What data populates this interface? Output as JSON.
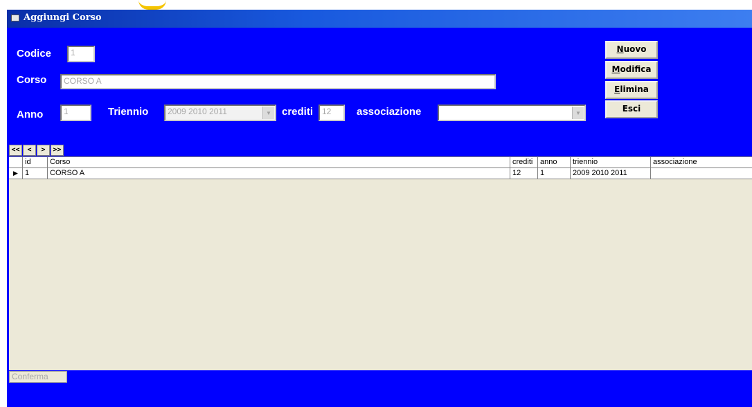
{
  "window": {
    "title": "Aggiungi Corso"
  },
  "form": {
    "codice_label": "Codice",
    "codice_value": "1",
    "corso_label": "Corso",
    "corso_value": "CORSO A",
    "anno_label": "Anno",
    "anno_value": "1",
    "triennio_label": "Triennio",
    "triennio_value": "2009 2010 2011",
    "crediti_label": "crediti",
    "crediti_value": "12",
    "associazione_label": "associazione",
    "associazione_value": ""
  },
  "buttons": {
    "nuovo_first": "N",
    "nuovo_rest": "uovo",
    "modifica_first": "M",
    "modifica_rest": "odifica",
    "elimina_first": "E",
    "elimina_rest": "limina",
    "esci": "Esci",
    "conferma": "Conferma"
  },
  "navigator": {
    "first": "<<",
    "prev": "<",
    "next": ">",
    "last": ">>"
  },
  "grid": {
    "headers": {
      "id": "id",
      "corso": "Corso",
      "crediti": "crediti",
      "anno": "anno",
      "triennio": "triennio",
      "associazione": "associazione"
    },
    "rows": [
      {
        "id": "1",
        "corso": "CORSO A",
        "crediti": "12",
        "anno": "1",
        "triennio": "2009 2010 2011",
        "associazione": ""
      }
    ]
  },
  "colors": {
    "form_background": "#0000ff",
    "grid_background": "#ece9d8"
  }
}
